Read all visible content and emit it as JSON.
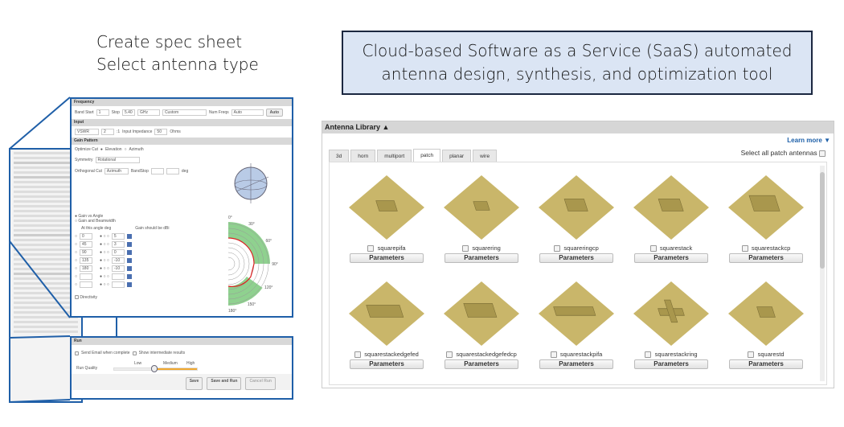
{
  "captions": {
    "left_line1": "Create spec sheet",
    "left_line2": "Select antenna type",
    "saas_line1": "Cloud-based Software as a Service (SaaS) automated",
    "saas_line2": "antenna design, synthesis, and optimization tool"
  },
  "library": {
    "title": "Antenna Library ▲",
    "learn_more": "Learn more ▼",
    "select_all": "Select all patch antennas",
    "tabs": [
      {
        "label": "3d"
      },
      {
        "label": "horn"
      },
      {
        "label": "multiport"
      },
      {
        "label": "patch",
        "active": true
      },
      {
        "label": "planar"
      },
      {
        "label": "wire"
      }
    ],
    "items": [
      {
        "name": "squarepifa",
        "shape": "box"
      },
      {
        "name": "squarering",
        "shape": "ring"
      },
      {
        "name": "squareringcp",
        "shape": "ringcp"
      },
      {
        "name": "squarestack",
        "shape": "stack"
      },
      {
        "name": "squarestackcp",
        "shape": "stackcp"
      },
      {
        "name": "squarestackedgefed",
        "shape": "long"
      },
      {
        "name": "squarestackedgefedcp",
        "shape": "longcp"
      },
      {
        "name": "squarestackpifa",
        "shape": "longpifa"
      },
      {
        "name": "squarestackring",
        "shape": "cross"
      },
      {
        "name": "squarestd",
        "shape": "flat"
      }
    ],
    "parameters_label": "Parameters",
    "colors": {
      "ground": "#c9b66a",
      "patch": "#a9974d",
      "accent": "#1c5fa8"
    }
  },
  "spec": {
    "frequency": {
      "header": "Frequency",
      "band_start_label": "Band Start",
      "band_start": "1",
      "stop_label": "Stop",
      "stop": "5.40",
      "unit": "GHz",
      "mode": "Custom",
      "num_freqs_label": "Num Freqs",
      "num_freqs": "Auto",
      "auto_button": "Auto"
    },
    "input": {
      "header": "Input",
      "type": "VSWR",
      "value": "2",
      "ratio": ":1",
      "impedance_label": "Input Impedance",
      "impedance": "50",
      "impedance_unit": "Ohms"
    },
    "gain": {
      "header": "Gain Pattern",
      "optimize_cut": "Optimize Cut",
      "elevation": "Elevation",
      "azimuth": "Azimuth",
      "symmetry_label": "Symmetry",
      "symmetry": "Rotational",
      "orth_label": "Orthogonal Cut",
      "orth_value": "Azimuth",
      "bandstop_label": "BandStop",
      "deg": "deg",
      "mode1": "Gain vs Angle",
      "mode2": "Gain and Beamwidth",
      "col1": "At this angle deg",
      "col2": "Gain should be dBi",
      "rows": [
        {
          "angle": "0",
          "gain": "5"
        },
        {
          "angle": "45",
          "gain": "3"
        },
        {
          "angle": "90",
          "gain": "0"
        },
        {
          "angle": "135",
          "gain": "-10"
        },
        {
          "angle": "180",
          "gain": "-10"
        },
        {
          "angle": "",
          "gain": ""
        },
        {
          "angle": "",
          "gain": ""
        }
      ],
      "directivity": "Directivity",
      "polar_labels": [
        "0°",
        "30°",
        "60°",
        "90°",
        "120°",
        "150°",
        "180°"
      ]
    },
    "run": {
      "header": "Run",
      "email": "Send Email when complete",
      "intermediate": "Show intermediate results",
      "quality_label": "Run Quality",
      "low": "Low",
      "medium": "Medium",
      "high": "High",
      "quality": 0.5,
      "save": "Save",
      "save_run": "Save and Run",
      "cancel": "Cancel Run"
    }
  }
}
